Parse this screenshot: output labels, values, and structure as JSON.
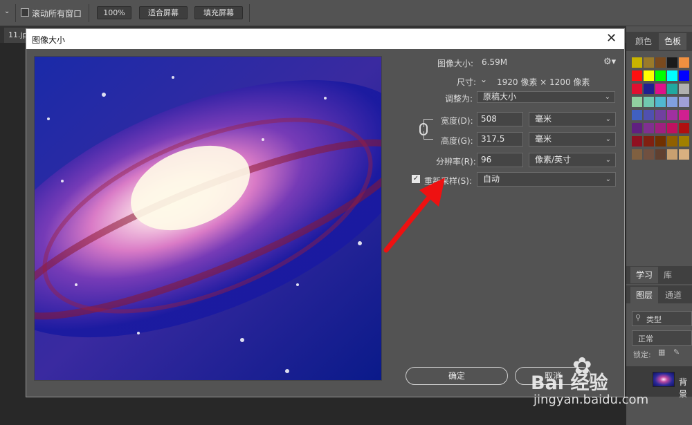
{
  "options_bar": {
    "scroll_all_label": "滚动所有窗口",
    "zoom_100": "100%",
    "fit_screen": "适合屏幕",
    "fill_screen": "填充屏幕"
  },
  "document_tab": {
    "name": "11.jp"
  },
  "right_panel": {
    "swatch_tabs": [
      "颜色",
      "色板"
    ],
    "learn_tabs": [
      "学习",
      "库"
    ],
    "layer_tabs": [
      "图层",
      "通道"
    ],
    "filter_kind": "类型",
    "blend_mode": "正常",
    "lock_label": "锁定:",
    "layer_name": "背景",
    "swatch_colors": [
      [
        "#c8b400",
        "#9a7a2a",
        "#7a4a1e",
        "#1a1a1a",
        "#f09040"
      ],
      [
        "#ff1010",
        "#ffff00",
        "#00ff00",
        "#00ffff",
        "#0000ff"
      ],
      [
        "#e01030",
        "#202090",
        "#e0108a",
        "#20a8a0",
        "#b0b0b0"
      ],
      [
        "#90d0a0",
        "#70c8b0",
        "#50b8d0",
        "#80a0e0",
        "#a0a0d8"
      ],
      [
        "#4060c0",
        "#5050b0",
        "#7040a0",
        "#a030a0",
        "#d02090"
      ],
      [
        "#602080",
        "#803090",
        "#a02080",
        "#c01060",
        "#b01010"
      ],
      [
        "#901020",
        "#802010",
        "#703000",
        "#906000",
        "#a08000"
      ],
      [
        "#806040",
        "#705040",
        "#604030",
        "#c8a070",
        "#d8b080"
      ]
    ]
  },
  "dialog": {
    "title": "图像大小",
    "image_size_label": "图像大小:",
    "image_size_value": "6.59M",
    "dimensions_label": "尺寸:",
    "dimensions_value": "1920 像素 × 1200 像素",
    "fit_to_label": "调整为:",
    "fit_to_value": "原稿大小",
    "width_label": "宽度(D):",
    "width_value": "508",
    "width_unit": "毫米",
    "height_label": "高度(G):",
    "height_value": "317.5",
    "height_unit": "毫米",
    "resolution_label": "分辨率(R):",
    "resolution_value": "96",
    "resolution_unit": "像素/英寸",
    "resample_label": "重新采样(S):",
    "resample_value": "自动",
    "ok_label": "确定",
    "cancel_label": "取消"
  },
  "watermark": {
    "brand": "Bai 经验",
    "url": "jingyan.baidu.com"
  },
  "colors": {
    "annotation_arrow": "#ee1111",
    "panel_bg": "#535353"
  }
}
